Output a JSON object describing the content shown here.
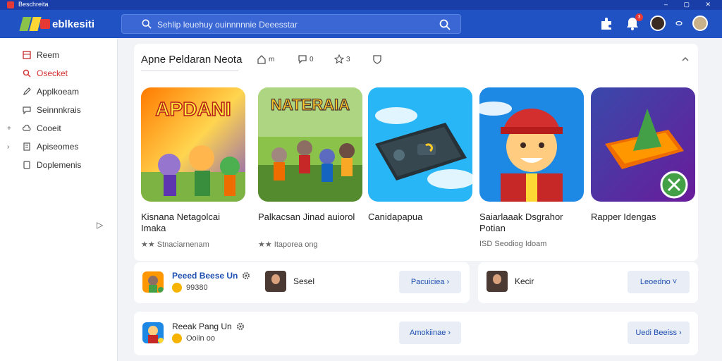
{
  "window": {
    "title": "Beschreita"
  },
  "header": {
    "logo_text": "eblkesiti",
    "search_placeholder": "Sehlip leuehuy ouinnnnnie Deeesstar",
    "notif_count": "3"
  },
  "sidebar": {
    "items": [
      {
        "label": "Reem",
        "icon": "grid-icon",
        "active": false
      },
      {
        "label": "Osecket",
        "icon": "search-icon",
        "active": true
      },
      {
        "label": "Applkoeam",
        "icon": "pencil-icon",
        "active": false
      },
      {
        "label": "Seinnnkrais",
        "icon": "chat-icon",
        "active": false
      },
      {
        "label": "Cooeit",
        "icon": "cloud-icon",
        "active": false
      },
      {
        "label": "Apiseomes",
        "icon": "doc-icon",
        "active": false
      },
      {
        "label": "Doplemenis",
        "icon": "page-icon",
        "active": false
      }
    ]
  },
  "panel": {
    "title": "Apne Peldaran Neota",
    "stats": [
      {
        "icon": "home-icon",
        "value": "m"
      },
      {
        "icon": "bubble-icon",
        "value": "0"
      },
      {
        "icon": "star-icon",
        "value": "3"
      },
      {
        "icon": "shield-icon",
        "value": ""
      }
    ],
    "cards": [
      {
        "title": "Kisnana Netagolcai Imaka",
        "sub": "★★ Stnaciarnenam",
        "thumb_label": "APDANI"
      },
      {
        "title": "Palkacsan Jinad auiorol",
        "sub": "★★ Itaporea ong",
        "thumb_label": "NATERAIA"
      },
      {
        "title": "Canidapapua",
        "sub": "",
        "thumb_label": ""
      },
      {
        "title": "Saiarlaaak Dsgrahor Potian",
        "sub": "ISD Seodiog Idoam",
        "thumb_label": ""
      },
      {
        "title": "Rapper Idengas",
        "sub": "",
        "thumb_label": ""
      }
    ]
  },
  "rows": [
    {
      "game": "Peeed Beese Un",
      "meta": "99380",
      "person": "Sesel",
      "button": "Pacuiciea"
    },
    {
      "game": "",
      "meta": "",
      "person": "Kecir",
      "button": "Leoedno"
    },
    {
      "game": "Reeak Pang Un",
      "meta": "Ooiin oo",
      "person": "",
      "button": "Amokiinae"
    },
    {
      "game": "",
      "meta": "",
      "person": "",
      "button": "Uedi Beeiss"
    }
  ],
  "colors": {
    "header": "#2052c4",
    "accent": "#1e4fb0",
    "active": "#d32f2f"
  }
}
